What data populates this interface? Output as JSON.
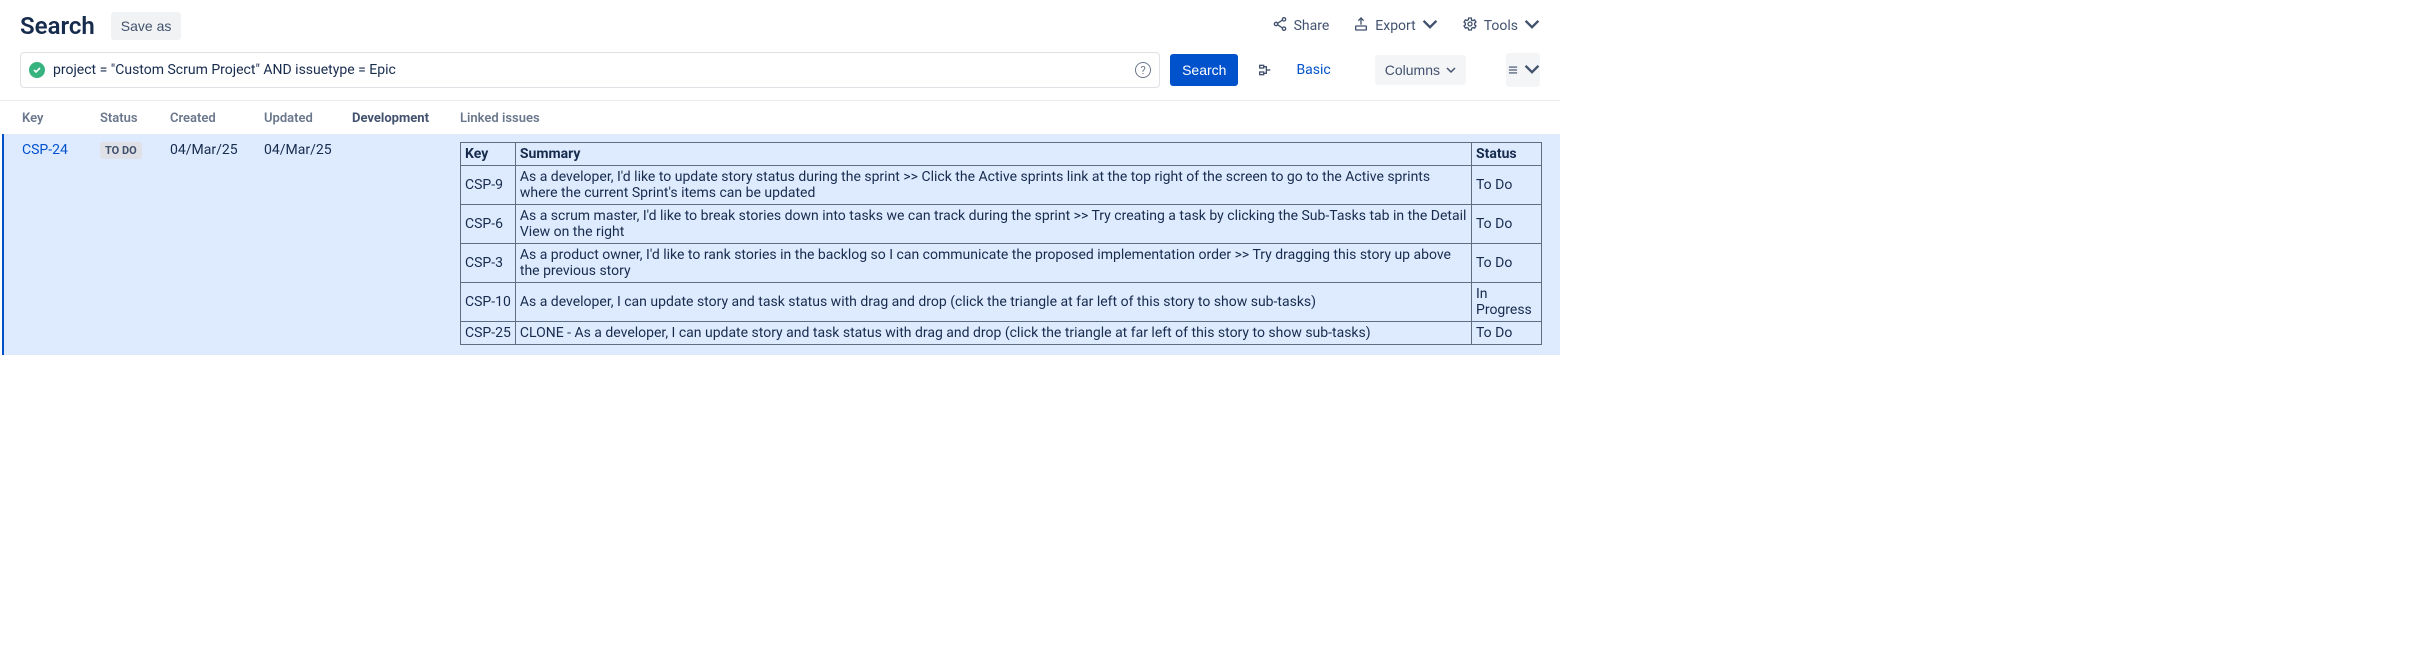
{
  "header": {
    "title": "Search",
    "save_as": "Save as",
    "share": "Share",
    "export": "Export",
    "tools": "Tools"
  },
  "search": {
    "jql": "project = \"Custom Scrum Project\" AND issuetype = Epic",
    "button": "Search",
    "basic": "Basic",
    "columns": "Columns"
  },
  "columns": {
    "key": "Key",
    "status": "Status",
    "created": "Created",
    "updated": "Updated",
    "development": "Development",
    "linked": "Linked issues"
  },
  "row": {
    "key": "CSP-24",
    "status": "TO DO",
    "created": "04/Mar/25",
    "updated": "04/Mar/25"
  },
  "linked_headers": {
    "key": "Key",
    "summary": "Summary",
    "status": "Status"
  },
  "linked": [
    {
      "key": "CSP-9",
      "summary": "As a developer, I'd like to update story status during the sprint >> Click the Active sprints link at the top right of the screen to go to the Active sprints where the current Sprint's items can be updated",
      "status": "To Do"
    },
    {
      "key": "CSP-6",
      "summary": "As a scrum master, I'd like to break stories down into tasks we can track during the sprint >> Try creating a task by clicking the Sub-Tasks tab in the Detail View on the right",
      "status": "To Do"
    },
    {
      "key": "CSP-3",
      "summary": "As a product owner, I'd like to rank stories in the backlog so I can communicate the proposed implementation order >> Try dragging this story up above the previous story",
      "status": "To Do"
    },
    {
      "key": "CSP-10",
      "summary": "As a developer, I can update story and task status with drag and drop (click the triangle at far left of this story to show sub-tasks)",
      "status": "In Progress"
    },
    {
      "key": "CSP-25",
      "summary": "CLONE - As a developer, I can update story and task status with drag and drop (click the triangle at far left of this story to show sub-tasks)",
      "status": "To Do"
    }
  ]
}
